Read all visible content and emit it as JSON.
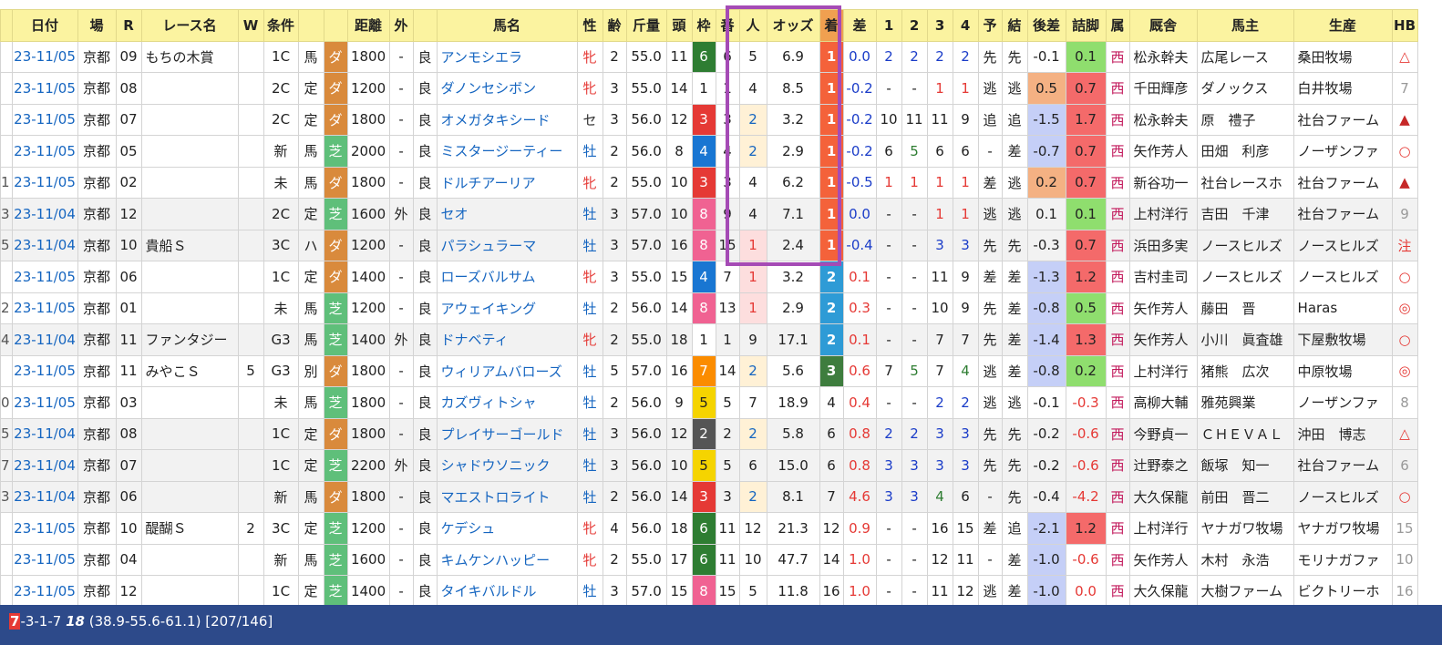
{
  "headers": [
    "",
    "日付",
    "場",
    "R",
    "レース名",
    "W",
    "条件",
    "",
    "",
    "距離",
    "外",
    "",
    "馬名",
    "性",
    "齢",
    "斤量",
    "頭",
    "枠",
    "番",
    "人",
    "オッズ",
    "着",
    "差",
    "1",
    "2",
    "3",
    "4",
    "予",
    "結",
    "後差",
    "詰脚",
    "属",
    "厩舎",
    "馬主",
    "生産",
    "HB"
  ],
  "rows": [
    {
      "idx": "",
      "date": "23-11/05",
      "track": "京都",
      "r": "09",
      "race": "もちの木賞",
      "w": "",
      "cls": "1C",
      "cond": "馬",
      "surf": "ダ",
      "dist": "1800",
      "out": "-",
      "going": "良",
      "name": "アンモシエラ",
      "sex": "牝",
      "age": "2",
      "wt": "55.0",
      "heads": "11",
      "waku": "6",
      "ban": "6",
      "pop": "5",
      "odds": "6.9",
      "fin": "1",
      "diff": "0.0",
      "c1": "2",
      "c2": "2",
      "c3": "2",
      "c4": "2",
      "yo": "先",
      "ke": "先",
      "lag": "-0.1",
      "fl": "0.1",
      "zoku": "西",
      "stable": "松永幹夫",
      "owner": "広尾レース",
      "breeder": "桑田牧場",
      "hb": "△"
    },
    {
      "idx": "",
      "date": "23-11/05",
      "track": "京都",
      "r": "08",
      "race": "",
      "w": "",
      "cls": "2C",
      "cond": "定",
      "surf": "ダ",
      "dist": "1200",
      "out": "-",
      "going": "良",
      "name": "ダノンセシボン",
      "sex": "牝",
      "age": "3",
      "wt": "55.0",
      "heads": "14",
      "waku": "1",
      "ban": "1",
      "pop": "4",
      "odds": "8.5",
      "fin": "1",
      "diff": "-0.2",
      "c1": "-",
      "c2": "-",
      "c3": "1",
      "c4": "1",
      "yo": "逃",
      "ke": "逃",
      "lag": "0.5",
      "fl": "0.7",
      "zoku": "西",
      "stable": "千田輝彦",
      "owner": "ダノックス",
      "breeder": "白井牧場",
      "hb": "7"
    },
    {
      "idx": "",
      "date": "23-11/05",
      "track": "京都",
      "r": "07",
      "race": "",
      "w": "",
      "cls": "2C",
      "cond": "定",
      "surf": "ダ",
      "dist": "1800",
      "out": "-",
      "going": "良",
      "name": "オメガタキシード",
      "sex": "セ",
      "age": "3",
      "wt": "56.0",
      "heads": "12",
      "waku": "3",
      "ban": "3",
      "pop": "2",
      "odds": "3.2",
      "fin": "1",
      "diff": "-0.2",
      "c1": "10",
      "c2": "11",
      "c3": "11",
      "c4": "9",
      "yo": "追",
      "ke": "追",
      "lag": "-1.5",
      "fl": "1.7",
      "zoku": "西",
      "stable": "松永幹夫",
      "owner": "原　禮子",
      "breeder": "社台ファーム",
      "hb": "▲"
    },
    {
      "idx": "",
      "date": "23-11/05",
      "track": "京都",
      "r": "05",
      "race": "",
      "w": "",
      "cls": "新",
      "cond": "馬",
      "surf": "芝",
      "dist": "2000",
      "out": "-",
      "going": "良",
      "name": "ミスタージーティー",
      "sex": "牡",
      "age": "2",
      "wt": "56.0",
      "heads": "8",
      "waku": "4",
      "ban": "4",
      "pop": "2",
      "odds": "2.9",
      "fin": "1",
      "diff": "-0.2",
      "c1": "6",
      "c2": "5",
      "c3": "6",
      "c4": "6",
      "yo": "-",
      "ke": "差",
      "lag": "-0.7",
      "fl": "0.7",
      "zoku": "西",
      "stable": "矢作芳人",
      "owner": "田畑　利彦",
      "breeder": "ノーザンファ",
      "hb": "○"
    },
    {
      "idx": "1",
      "date": "23-11/05",
      "track": "京都",
      "r": "02",
      "race": "",
      "w": "",
      "cls": "未",
      "cond": "馬",
      "surf": "ダ",
      "dist": "1800",
      "out": "-",
      "going": "良",
      "name": "ドルチアーリア",
      "sex": "牝",
      "age": "2",
      "wt": "55.0",
      "heads": "10",
      "waku": "3",
      "ban": "3",
      "pop": "4",
      "odds": "6.2",
      "fin": "1",
      "diff": "-0.5",
      "c1": "1",
      "c2": "1",
      "c3": "1",
      "c4": "1",
      "yo": "差",
      "ke": "逃",
      "lag": "0.2",
      "fl": "0.7",
      "zoku": "西",
      "stable": "新谷功一",
      "owner": "社台レースホ",
      "breeder": "社台ファーム",
      "hb": "▲"
    },
    {
      "idx": "3",
      "date": "23-11/04",
      "track": "京都",
      "r": "12",
      "race": "",
      "w": "",
      "cls": "2C",
      "cond": "定",
      "surf": "芝",
      "dist": "1600",
      "out": "外",
      "going": "良",
      "name": "セオ",
      "sex": "牡",
      "age": "3",
      "wt": "57.0",
      "heads": "10",
      "waku": "8",
      "ban": "9",
      "pop": "4",
      "odds": "7.1",
      "fin": "1",
      "diff": "0.0",
      "c1": "-",
      "c2": "-",
      "c3": "1",
      "c4": "1",
      "yo": "逃",
      "ke": "逃",
      "lag": "0.1",
      "fl": "0.1",
      "zoku": "西",
      "stable": "上村洋行",
      "owner": "吉田　千津",
      "breeder": "社台ファーム",
      "hb": "9"
    },
    {
      "idx": "5",
      "date": "23-11/04",
      "track": "京都",
      "r": "10",
      "race": "貴船Ｓ",
      "w": "",
      "cls": "3C",
      "cond": "ハ",
      "surf": "ダ",
      "dist": "1200",
      "out": "-",
      "going": "良",
      "name": "パラシュラーマ",
      "sex": "牡",
      "age": "3",
      "wt": "57.0",
      "heads": "16",
      "waku": "8",
      "ban": "15",
      "pop": "1",
      "odds": "2.4",
      "fin": "1",
      "diff": "-0.4",
      "c1": "-",
      "c2": "-",
      "c3": "3",
      "c4": "3",
      "yo": "先",
      "ke": "先",
      "lag": "-0.3",
      "fl": "0.7",
      "zoku": "西",
      "stable": "浜田多実",
      "owner": "ノースヒルズ",
      "breeder": "ノースヒルズ",
      "hb": "注"
    },
    {
      "idx": "",
      "date": "23-11/05",
      "track": "京都",
      "r": "06",
      "race": "",
      "w": "",
      "cls": "1C",
      "cond": "定",
      "surf": "ダ",
      "dist": "1400",
      "out": "-",
      "going": "良",
      "name": "ローズバルサム",
      "sex": "牝",
      "age": "3",
      "wt": "55.0",
      "heads": "15",
      "waku": "4",
      "ban": "7",
      "pop": "1",
      "odds": "3.2",
      "fin": "2",
      "diff": "0.1",
      "c1": "-",
      "c2": "-",
      "c3": "11",
      "c4": "9",
      "yo": "差",
      "ke": "差",
      "lag": "-1.3",
      "fl": "1.2",
      "zoku": "西",
      "stable": "吉村圭司",
      "owner": "ノースヒルズ",
      "breeder": "ノースヒルズ",
      "hb": "○"
    },
    {
      "idx": "2",
      "date": "23-11/05",
      "track": "京都",
      "r": "01",
      "race": "",
      "w": "",
      "cls": "未",
      "cond": "馬",
      "surf": "芝",
      "dist": "1200",
      "out": "-",
      "going": "良",
      "name": "アウェイキング",
      "sex": "牡",
      "age": "2",
      "wt": "56.0",
      "heads": "14",
      "waku": "8",
      "ban": "13",
      "pop": "1",
      "odds": "2.9",
      "fin": "2",
      "diff": "0.3",
      "c1": "-",
      "c2": "-",
      "c3": "10",
      "c4": "9",
      "yo": "先",
      "ke": "差",
      "lag": "-0.8",
      "fl": "0.5",
      "zoku": "西",
      "stable": "矢作芳人",
      "owner": "藤田　晋",
      "breeder": "Haras",
      "hb": "◎"
    },
    {
      "idx": "4",
      "date": "23-11/04",
      "track": "京都",
      "r": "11",
      "race": "ファンタジー",
      "w": "",
      "cls": "G3",
      "cond": "馬",
      "surf": "芝",
      "dist": "1400",
      "out": "外",
      "going": "良",
      "name": "ドナベティ",
      "sex": "牝",
      "age": "2",
      "wt": "55.0",
      "heads": "18",
      "waku": "1",
      "ban": "1",
      "pop": "9",
      "odds": "17.1",
      "fin": "2",
      "diff": "0.1",
      "c1": "-",
      "c2": "-",
      "c3": "7",
      "c4": "7",
      "yo": "先",
      "ke": "差",
      "lag": "-1.4",
      "fl": "1.3",
      "zoku": "西",
      "stable": "矢作芳人",
      "owner": "小川　眞査雄",
      "breeder": "下屋敷牧場",
      "hb": "○"
    },
    {
      "idx": "",
      "date": "23-11/05",
      "track": "京都",
      "r": "11",
      "race": "みやこＳ",
      "w": "5",
      "cls": "G3",
      "cond": "別",
      "surf": "ダ",
      "dist": "1800",
      "out": "-",
      "going": "良",
      "name": "ウィリアムバローズ",
      "sex": "牡",
      "age": "5",
      "wt": "57.0",
      "heads": "16",
      "waku": "7",
      "ban": "14",
      "pop": "2",
      "odds": "5.6",
      "fin": "3",
      "diff": "0.6",
      "c1": "7",
      "c2": "5",
      "c3": "7",
      "c4": "4",
      "yo": "逃",
      "ke": "差",
      "lag": "-0.8",
      "fl": "0.2",
      "zoku": "西",
      "stable": "上村洋行",
      "owner": "猪熊　広次",
      "breeder": "中原牧場",
      "hb": "◎"
    },
    {
      "idx": "0",
      "date": "23-11/05",
      "track": "京都",
      "r": "03",
      "race": "",
      "w": "",
      "cls": "未",
      "cond": "馬",
      "surf": "芝",
      "dist": "1800",
      "out": "-",
      "going": "良",
      "name": "カズヴィトシャ",
      "sex": "牡",
      "age": "2",
      "wt": "56.0",
      "heads": "9",
      "waku": "5",
      "ban": "5",
      "pop": "7",
      "odds": "18.9",
      "fin": "4",
      "diff": "0.4",
      "c1": "-",
      "c2": "-",
      "c3": "2",
      "c4": "2",
      "yo": "逃",
      "ke": "逃",
      "lag": "-0.1",
      "fl": "-0.3",
      "zoku": "西",
      "stable": "高柳大輔",
      "owner": "雅苑興業",
      "breeder": "ノーザンファ",
      "hb": "8"
    },
    {
      "idx": "5",
      "date": "23-11/04",
      "track": "京都",
      "r": "08",
      "race": "",
      "w": "",
      "cls": "1C",
      "cond": "定",
      "surf": "ダ",
      "dist": "1800",
      "out": "-",
      "going": "良",
      "name": "プレイサーゴールド",
      "sex": "牡",
      "age": "3",
      "wt": "56.0",
      "heads": "12",
      "waku": "2",
      "ban": "2",
      "pop": "2",
      "odds": "5.8",
      "fin": "6",
      "diff": "0.8",
      "c1": "2",
      "c2": "2",
      "c3": "3",
      "c4": "3",
      "yo": "先",
      "ke": "先",
      "lag": "-0.2",
      "fl": "-0.6",
      "zoku": "西",
      "stable": "今野貞一",
      "owner": "ＣＨＥＶＡＬ",
      "breeder": "沖田　博志",
      "hb": "△"
    },
    {
      "idx": "7",
      "date": "23-11/04",
      "track": "京都",
      "r": "07",
      "race": "",
      "w": "",
      "cls": "1C",
      "cond": "定",
      "surf": "芝",
      "dist": "2200",
      "out": "外",
      "going": "良",
      "name": "シャドウソニック",
      "sex": "牡",
      "age": "3",
      "wt": "56.0",
      "heads": "10",
      "waku": "5",
      "ban": "5",
      "pop": "6",
      "odds": "15.0",
      "fin": "6",
      "diff": "0.8",
      "c1": "3",
      "c2": "3",
      "c3": "3",
      "c4": "3",
      "yo": "先",
      "ke": "先",
      "lag": "-0.2",
      "fl": "-0.6",
      "zoku": "西",
      "stable": "辻野泰之",
      "owner": "飯塚　知一",
      "breeder": "社台ファーム",
      "hb": "6"
    },
    {
      "idx": "3",
      "date": "23-11/04",
      "track": "京都",
      "r": "06",
      "race": "",
      "w": "",
      "cls": "新",
      "cond": "馬",
      "surf": "ダ",
      "dist": "1800",
      "out": "-",
      "going": "良",
      "name": "マエストロライト",
      "sex": "牡",
      "age": "2",
      "wt": "56.0",
      "heads": "14",
      "waku": "3",
      "ban": "3",
      "pop": "2",
      "odds": "8.1",
      "fin": "7",
      "diff": "4.6",
      "c1": "3",
      "c2": "3",
      "c3": "4",
      "c4": "6",
      "yo": "-",
      "ke": "先",
      "lag": "-0.4",
      "fl": "-4.2",
      "zoku": "西",
      "stable": "大久保龍",
      "owner": "前田　晋二",
      "breeder": "ノースヒルズ",
      "hb": "○"
    },
    {
      "idx": "",
      "date": "23-11/05",
      "track": "京都",
      "r": "10",
      "race": "醍醐Ｓ",
      "w": "2",
      "cls": "3C",
      "cond": "定",
      "surf": "芝",
      "dist": "1200",
      "out": "-",
      "going": "良",
      "name": "ケデシュ",
      "sex": "牝",
      "age": "4",
      "wt": "56.0",
      "heads": "18",
      "waku": "6",
      "ban": "11",
      "pop": "12",
      "odds": "21.3",
      "fin": "12",
      "diff": "0.9",
      "c1": "-",
      "c2": "-",
      "c3": "16",
      "c4": "15",
      "yo": "差",
      "ke": "追",
      "lag": "-2.1",
      "fl": "1.2",
      "zoku": "西",
      "stable": "上村洋行",
      "owner": "ヤナガワ牧場",
      "breeder": "ヤナガワ牧場",
      "hb": "15"
    },
    {
      "idx": "",
      "date": "23-11/05",
      "track": "京都",
      "r": "04",
      "race": "",
      "w": "",
      "cls": "新",
      "cond": "馬",
      "surf": "芝",
      "dist": "1600",
      "out": "-",
      "going": "良",
      "name": "キムケンハッピー",
      "sex": "牝",
      "age": "2",
      "wt": "55.0",
      "heads": "17",
      "waku": "6",
      "ban": "11",
      "pop": "10",
      "odds": "47.7",
      "fin": "14",
      "diff": "1.0",
      "c1": "-",
      "c2": "-",
      "c3": "12",
      "c4": "11",
      "yo": "-",
      "ke": "差",
      "lag": "-1.0",
      "fl": "-0.6",
      "zoku": "西",
      "stable": "矢作芳人",
      "owner": "木村　永浩",
      "breeder": "モリナガファ",
      "hb": "10"
    },
    {
      "idx": "",
      "date": "23-11/05",
      "track": "京都",
      "r": "12",
      "race": "",
      "w": "",
      "cls": "1C",
      "cond": "定",
      "surf": "芝",
      "dist": "1400",
      "out": "-",
      "going": "良",
      "name": "タイキバルドル",
      "sex": "牡",
      "age": "3",
      "wt": "57.0",
      "heads": "15",
      "waku": "8",
      "ban": "15",
      "pop": "5",
      "odds": "11.8",
      "fin": "16",
      "diff": "1.0",
      "c1": "-",
      "c2": "-",
      "c3": "11",
      "c4": "12",
      "yo": "逃",
      "ke": "差",
      "lag": "-1.0",
      "fl": "0.0",
      "zoku": "西",
      "stable": "大久保龍",
      "owner": "大樹ファーム",
      "breeder": "ビクトリーホ",
      "hb": "16"
    }
  ],
  "footer": {
    "lead": "7",
    "rest1": "-3-1-7 ",
    "bold": "18",
    "rest2": " (38.9-55.6-61.1) [207/146]"
  }
}
